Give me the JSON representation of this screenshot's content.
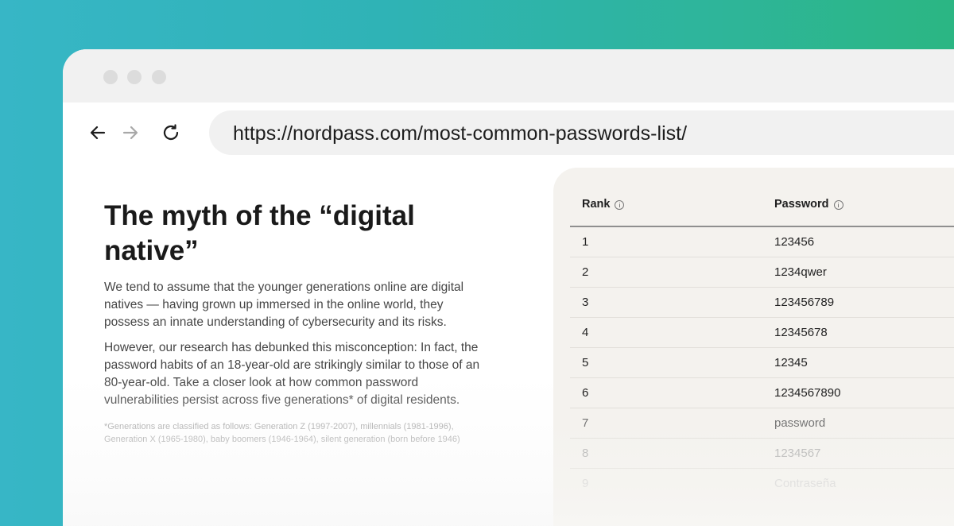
{
  "browser": {
    "url": "https://nordpass.com/most-common-passwords-list/"
  },
  "article": {
    "title": "The myth of the “digital native”",
    "paragraph1": "We tend to assume that the younger generations online are digital natives — having grown up immersed in the online world, they possess an innate understanding of cybersecurity and its risks.",
    "paragraph2": "However, our research has debunked this misconception: In fact, the password habits of an 18-year-old are strikingly similar to those of an 80-year-old. Take a closer look at how common password vulnerabilities persist across five generations* of digital residents.",
    "footnote": "*Generations are classified as follows: Generation Z (1997-2007), millennials (1981-1996), Generation X (1965-1980), baby boomers (1946-1964), silent generation (born before 1946)"
  },
  "table": {
    "columns": [
      {
        "label": "Rank",
        "icon": "info-icon"
      },
      {
        "label": "Password",
        "icon": "info-icon"
      }
    ],
    "rows": [
      {
        "rank": "1",
        "password": "123456"
      },
      {
        "rank": "2",
        "password": "1234qwer"
      },
      {
        "rank": "3",
        "password": "123456789"
      },
      {
        "rank": "4",
        "password": "12345678"
      },
      {
        "rank": "5",
        "password": "12345"
      },
      {
        "rank": "6",
        "password": "1234567890"
      },
      {
        "rank": "7",
        "password": "password"
      },
      {
        "rank": "8",
        "password": "1234567"
      },
      {
        "rank": "9",
        "password": "Contraseña"
      }
    ]
  },
  "icons": {
    "back": "arrow-left-icon",
    "forward": "arrow-right-icon",
    "reload": "reload-icon"
  },
  "colors": {
    "background_start": "#37b6c6",
    "background_end": "#2bb683",
    "panel": "#f4f2ee"
  }
}
